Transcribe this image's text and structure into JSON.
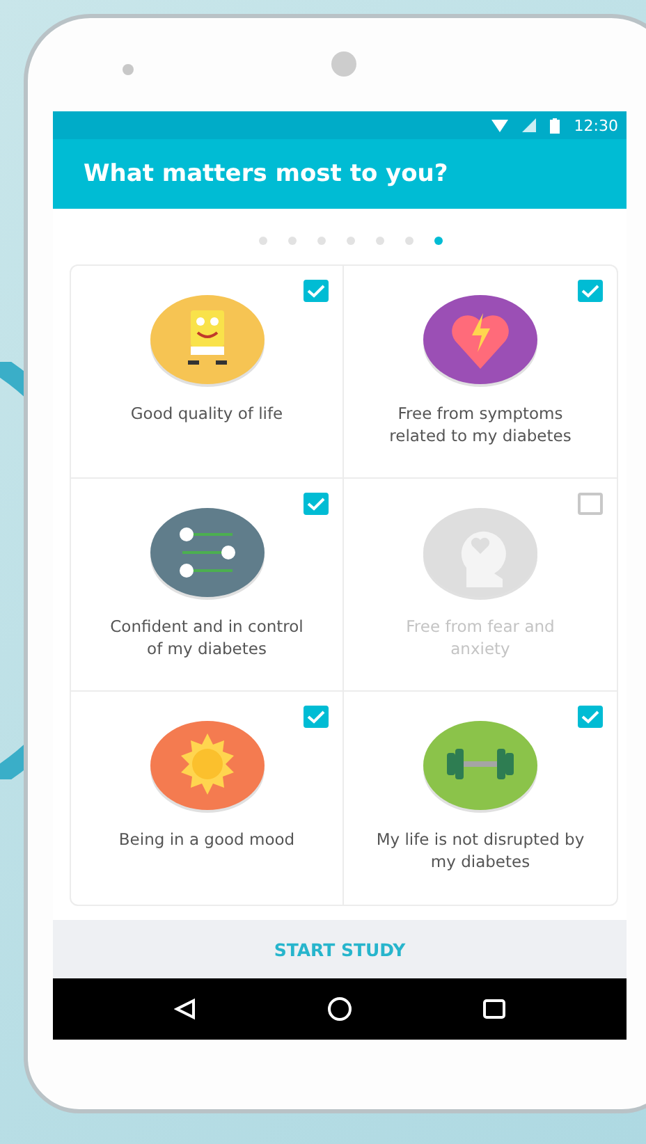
{
  "status_bar": {
    "time": "12:30"
  },
  "app_bar": {
    "title": "What matters most to you?"
  },
  "pager": [
    {
      "selected": false
    },
    {
      "selected": false
    },
    {
      "selected": false
    },
    {
      "selected": false
    },
    {
      "selected": false
    },
    {
      "selected": false
    },
    {
      "selected": true
    }
  ],
  "options": [
    {
      "label": "Good quality of life",
      "checked": true,
      "kind": "character",
      "color": "#f6c453"
    },
    {
      "label": "Free from symptoms related to my diabetes",
      "checked": true,
      "kind": "heart",
      "color": "#9b4fb5"
    },
    {
      "label": "Confident and in control of my diabetes",
      "checked": true,
      "kind": "sliders",
      "color": "#607d8b"
    },
    {
      "label": "Free from fear and anxiety",
      "checked": false,
      "kind": "head",
      "color": "#dedede"
    },
    {
      "label": "Being in a good mood",
      "checked": true,
      "kind": "sun",
      "color": "#f47b50"
    },
    {
      "label": "My life is not disrupted by my diabetes",
      "checked": true,
      "kind": "dumbbell",
      "color": "#8bc34a"
    }
  ],
  "footer": {
    "button": "START STUDY"
  }
}
